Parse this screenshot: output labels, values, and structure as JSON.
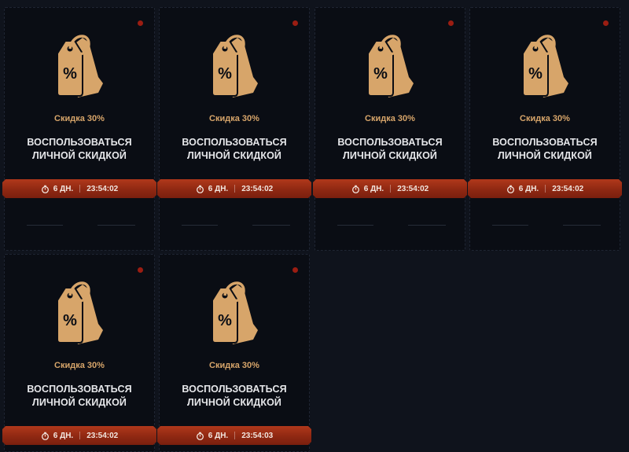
{
  "colors": {
    "background": "#0f131c",
    "card": "#0a0d14",
    "accent_gold": "#d7a56a",
    "timer_red": "#9c2d15",
    "status_dot": "#9b1d12"
  },
  "cards": [
    {
      "icon": "discount-tag-icon",
      "discount": "Скидка 30%",
      "action_line1": "ВОСПОЛЬЗОВАТЬСЯ",
      "action_line2": "ЛИЧНОЙ СКИДКОЙ",
      "days": "6 ДН.",
      "time": "23:54:02"
    },
    {
      "icon": "discount-tag-icon",
      "discount": "Скидка 30%",
      "action_line1": "ВОСПОЛЬЗОВАТЬСЯ",
      "action_line2": "ЛИЧНОЙ СКИДКОЙ",
      "days": "6 ДН.",
      "time": "23:54:02"
    },
    {
      "icon": "discount-tag-icon",
      "discount": "Скидка 30%",
      "action_line1": "ВОСПОЛЬЗОВАТЬСЯ",
      "action_line2": "ЛИЧНОЙ СКИДКОЙ",
      "days": "6 ДН.",
      "time": "23:54:02"
    },
    {
      "icon": "discount-tag-icon",
      "discount": "Скидка 30%",
      "action_line1": "ВОСПОЛЬЗОВАТЬСЯ",
      "action_line2": "ЛИЧНОЙ СКИДКОЙ",
      "days": "6 ДН.",
      "time": "23:54:02"
    },
    {
      "icon": "discount-tag-icon",
      "discount": "Скидка 30%",
      "action_line1": "ВОСПОЛЬЗОВАТЬСЯ",
      "action_line2": "ЛИЧНОЙ СКИДКОЙ",
      "days": "6 ДН.",
      "time": "23:54:02"
    },
    {
      "icon": "discount-tag-icon",
      "discount": "Скидка 30%",
      "action_line1": "ВОСПОЛЬЗОВАТЬСЯ",
      "action_line2": "ЛИЧНОЙ СКИДКОЙ",
      "days": "6 ДН.",
      "time": "23:54:03"
    }
  ]
}
